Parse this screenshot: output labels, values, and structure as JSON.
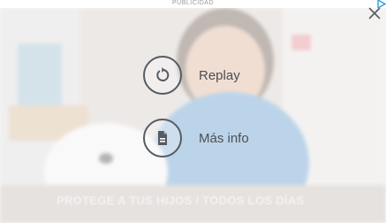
{
  "ad": {
    "label": "PUBLICIDAD",
    "adchoices_icon": "adchoices-icon"
  },
  "player": {
    "close_icon": "close-icon",
    "actions": [
      {
        "icon": "replay-icon",
        "label": "Replay"
      },
      {
        "icon": "document-icon",
        "label": "Más info"
      }
    ],
    "tagline": "PROTEGE A TUS HIJOS / TODOS LOS DÍAS"
  },
  "colors": {
    "icon_stroke": "#555b61",
    "label_text": "#4b4f54",
    "adchoices": "#2aa3d8"
  }
}
